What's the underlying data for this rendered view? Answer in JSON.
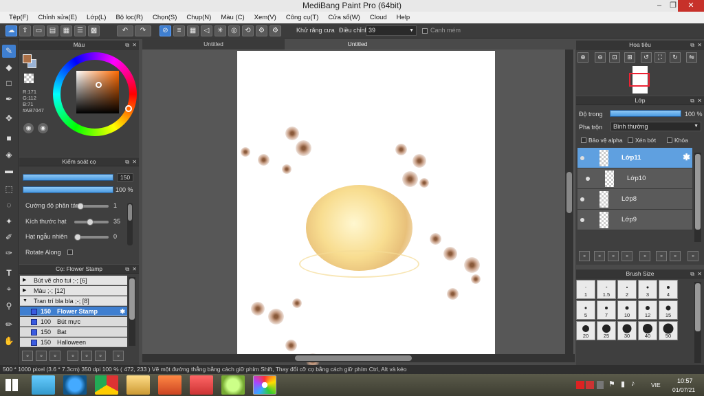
{
  "window": {
    "title": "MediBang Paint Pro (64bit)",
    "minimize": "–",
    "restore": "❐",
    "close": "✕"
  },
  "menu": [
    "Tệp(F)",
    "Chỉnh sửa(E)",
    "Lớp(L)",
    "Bộ lọc(R)",
    "Chọn(S)",
    "Chụp(N)",
    "Màu (C)",
    "Xem(V)",
    "Công cụ(T)",
    "Cửa sổ(W)",
    "Cloud",
    "Help"
  ],
  "toolbar": {
    "antialias_label": "Khử răng cưa",
    "correction_label": "Điều chỉnh",
    "correction_value": "39",
    "edge_label": "Canh mém"
  },
  "color_panel": {
    "title": "Màu",
    "r": "R:171",
    "g": "G:112",
    "b": "B:71",
    "hex": "#AB7047",
    "fg_color": "#ab7047",
    "bg_color": "#9ab3d6"
  },
  "brush_control": {
    "title": "Kiểm soát cọ",
    "size_value": "150",
    "opacity_value": "100 %",
    "params": [
      {
        "label": "Cường độ phân tán",
        "value": "1",
        "level": 0.08
      },
      {
        "label": "Kích thước hạt",
        "value": "35",
        "level": 0.35
      },
      {
        "label": "Hạt ngẫu nhiên",
        "value": "0",
        "level": 0.0
      }
    ],
    "rotate_label": "Rotate Along"
  },
  "brush_list": {
    "title": "Cọ: Flower Stamp",
    "categories": [
      {
        "arrow": "▶",
        "label": "Bút vẽ cho tui ;-; [6]"
      },
      {
        "arrow": "▶",
        "label": "Màu ;-; [12]"
      },
      {
        "arrow": "▼",
        "label": "Tran trí bla bla ;-; [8]"
      }
    ],
    "brushes": [
      {
        "size": "150",
        "name": "Flower Stamp",
        "selected": true
      },
      {
        "size": "100",
        "name": "Bút mực",
        "selected": false
      },
      {
        "size": "150",
        "name": "Bat",
        "selected": false
      },
      {
        "size": "150",
        "name": "Halloween",
        "selected": false
      }
    ]
  },
  "tabs": {
    "inactive": "Untitled",
    "active": "Untitled"
  },
  "navigator": {
    "title": "Hoa tiêu"
  },
  "layers": {
    "title": "Lớp",
    "opacity_label": "Độ trong",
    "opacity_value": "100 %",
    "blend_label": "Pha trộn",
    "blend_value": "Bình thường",
    "protect_alpha": "Bảo vệ alpha",
    "clipping": "Xén bớt",
    "lock": "Khóa",
    "items": [
      {
        "name": "Lớp11",
        "selected": true
      },
      {
        "name": "Lớp10",
        "selected": false
      },
      {
        "name": "Lớp8",
        "selected": false
      },
      {
        "name": "Lớp9",
        "selected": false
      }
    ]
  },
  "brush_size": {
    "title": "Brush Size",
    "sizes": [
      "1",
      "1.5",
      "2",
      "3",
      "4",
      "5",
      "7",
      "10",
      "12",
      "15",
      "20",
      "25",
      "30",
      "40",
      "50"
    ]
  },
  "status": {
    "text": "500 * 1000 pixel   (3.6 * 7.3cm)   350 dpi   100 %   ( 472, 233 )   Vẽ một đường thẳng bằng cách giữ phím Shift, Thay đổi cỡ cọ bằng cách giữ phím Ctrl, Alt và kéo"
  },
  "taskbar": {
    "lang": "VIE",
    "time": "10:57",
    "date": "01/07/21"
  }
}
